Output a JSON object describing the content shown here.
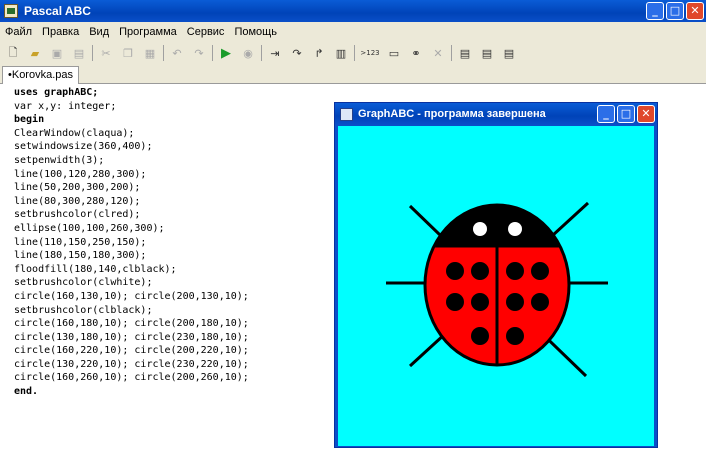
{
  "app": {
    "title": "Pascal ABC",
    "window_buttons": {
      "minimize": "_",
      "maximize": "□",
      "close": "✕"
    }
  },
  "menu": [
    "Файл",
    "Правка",
    "Вид",
    "Программа",
    "Сервис",
    "Помощь"
  ],
  "toolbar": {
    "buttons": [
      "new-file",
      "open-file",
      "save-file",
      "save-all",
      "cut",
      "copy",
      "paste",
      "undo",
      "redo",
      "run",
      "stop",
      "step-into",
      "step-over",
      "step-out",
      "watch",
      "output-123",
      "window",
      "comments",
      "close"
    ],
    "output_label": ">123"
  },
  "tab": {
    "label": "•Korovka.pas"
  },
  "code_lines": [
    "uses graphABC;",
    "var x,y: integer;",
    "begin",
    "ClearWindow(claqua);",
    "setwindowsize(360,400);",
    "setpenwidth(3);",
    "line(100,120,280,300);",
    "line(50,200,300,200);",
    "line(80,300,280,120);",
    "setbrushcolor(clred);",
    "ellipse(100,100,260,300);",
    "line(110,150,250,150);",
    "line(180,150,180,300);",
    "floodfill(180,140,clblack);",
    "setbrushcolor(clwhite);",
    "circle(160,130,10); circle(200,130,10);",
    "setbrushcolor(clblack);",
    "circle(160,180,10); circle(200,180,10);",
    "circle(130,180,10); circle(230,180,10);",
    "circle(160,220,10); circle(200,220,10);",
    "circle(130,220,10); circle(230,220,10);",
    "circle(160,260,10); circle(200,260,10);",
    "end."
  ],
  "graph_window": {
    "title": "GraphABC - программа завершена",
    "canvas_color": "#00ffff",
    "drawing": {
      "body_color": "#ff0000",
      "head_color": "#000000",
      "eye_color": "#ffffff",
      "spot_color": "#000000"
    }
  }
}
